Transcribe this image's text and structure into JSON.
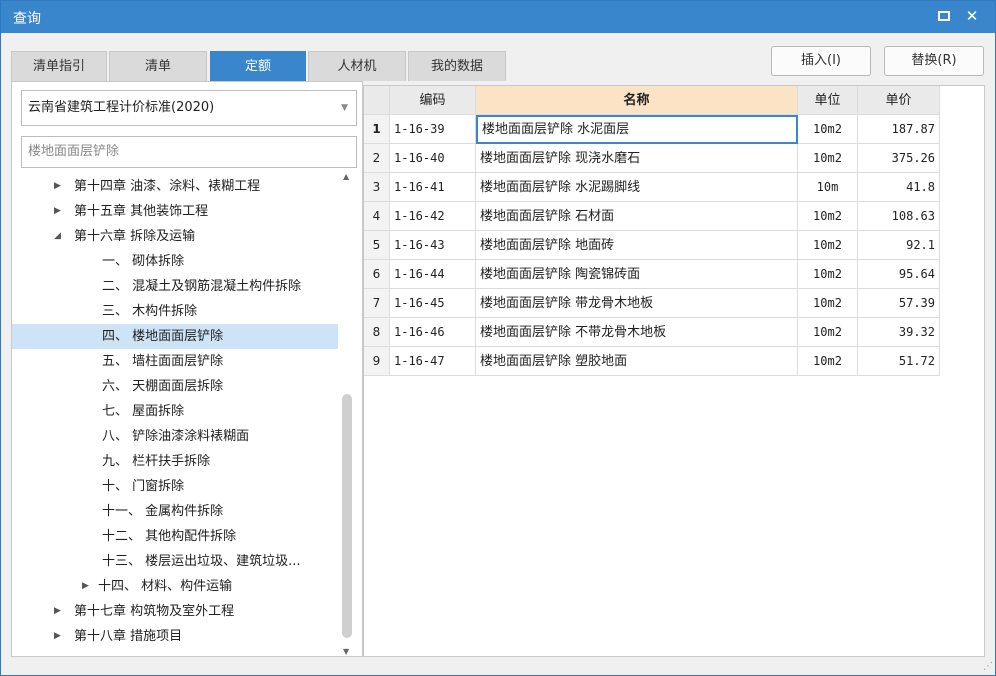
{
  "window": {
    "title": "查询",
    "maximize_icon": "maximize-icon",
    "close_symbol": "✕"
  },
  "tabs": [
    {
      "label": "清单指引",
      "active": false
    },
    {
      "label": "清单",
      "active": false
    },
    {
      "label": "定额",
      "active": true
    },
    {
      "label": "人材机",
      "active": false
    },
    {
      "label": "我的数据",
      "active": false
    }
  ],
  "actions": {
    "insert": "插入(I)",
    "replace": "替换(R)"
  },
  "standard_select": {
    "value": "云南省建筑工程计价标准(2020)"
  },
  "search": {
    "value": "楼地面面层铲除"
  },
  "tree": [
    {
      "label": "第十四章 油漆、涂料、裱糊工程",
      "level": 0,
      "expander": "▶"
    },
    {
      "label": "第十五章 其他装饰工程",
      "level": 0,
      "expander": "▶"
    },
    {
      "label": "第十六章 拆除及运输",
      "level": 0,
      "expander": "◢"
    },
    {
      "label": "一、 砌体拆除",
      "level": 1,
      "expander": ""
    },
    {
      "label": "二、 混凝土及钢筋混凝土构件拆除",
      "level": 1,
      "expander": ""
    },
    {
      "label": "三、 木构件拆除",
      "level": 1,
      "expander": ""
    },
    {
      "label": "四、 楼地面面层铲除",
      "level": 1,
      "expander": "",
      "selected": true
    },
    {
      "label": "五、 墙柱面面层铲除",
      "level": 1,
      "expander": ""
    },
    {
      "label": "六、 天棚面面层拆除",
      "level": 1,
      "expander": ""
    },
    {
      "label": "七、 屋面拆除",
      "level": 1,
      "expander": ""
    },
    {
      "label": "八、 铲除油漆涂料裱糊面",
      "level": 1,
      "expander": ""
    },
    {
      "label": "九、 栏杆扶手拆除",
      "level": 1,
      "expander": ""
    },
    {
      "label": "十、 门窗拆除",
      "level": 1,
      "expander": ""
    },
    {
      "label": "十一、 金属构件拆除",
      "level": 1,
      "expander": ""
    },
    {
      "label": "十二、 其他构配件拆除",
      "level": 1,
      "expander": ""
    },
    {
      "label": "十三、 楼层运出垃圾、建筑垃圾...",
      "level": 1,
      "expander": ""
    },
    {
      "label": "十四、 材料、构件运输",
      "level": 1,
      "expander": "▶"
    },
    {
      "label": "第十七章 构筑物及室外工程",
      "level": 0,
      "expander": "▶"
    },
    {
      "label": "第十八章 措施项目",
      "level": 0,
      "expander": "▶"
    }
  ],
  "table": {
    "headers": {
      "code": "编码",
      "name": "名称",
      "unit": "单位",
      "price": "单价"
    },
    "rows": [
      {
        "idx": "1",
        "code": "1-16-39",
        "name": "楼地面面层铲除 水泥面层",
        "unit": "10m2",
        "price": "187.87"
      },
      {
        "idx": "2",
        "code": "1-16-40",
        "name": "楼地面面层铲除 现浇水磨石",
        "unit": "10m2",
        "price": "375.26"
      },
      {
        "idx": "3",
        "code": "1-16-41",
        "name": "楼地面面层铲除 水泥踢脚线",
        "unit": "10m",
        "price": "41.8"
      },
      {
        "idx": "4",
        "code": "1-16-42",
        "name": "楼地面面层铲除 石材面",
        "unit": "10m2",
        "price": "108.63"
      },
      {
        "idx": "5",
        "code": "1-16-43",
        "name": "楼地面面层铲除 地面砖",
        "unit": "10m2",
        "price": "92.1"
      },
      {
        "idx": "6",
        "code": "1-16-44",
        "name": "楼地面面层铲除 陶瓷锦砖面",
        "unit": "10m2",
        "price": "95.64"
      },
      {
        "idx": "7",
        "code": "1-16-45",
        "name": "楼地面面层铲除 带龙骨木地板",
        "unit": "10m2",
        "price": "57.39"
      },
      {
        "idx": "8",
        "code": "1-16-46",
        "name": "楼地面面层铲除 不带龙骨木地板",
        "unit": "10m2",
        "price": "39.32"
      },
      {
        "idx": "9",
        "code": "1-16-47",
        "name": "楼地面面层铲除 塑胶地面",
        "unit": "10m2",
        "price": "51.72"
      }
    ]
  },
  "colors": {
    "accent": "#3a86cc",
    "selected_row": "#cde4f7",
    "header_highlight": "#fbe3c6"
  }
}
